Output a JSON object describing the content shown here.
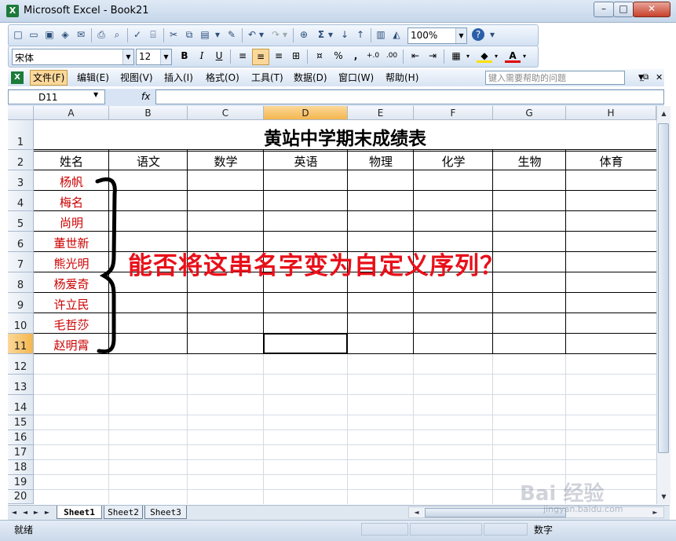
{
  "window": {
    "title": "Microsoft Excel - Book21",
    "app_icon": "excel-icon"
  },
  "toolbar": {
    "zoom": "100%",
    "font_name": "宋体",
    "font_size": "12",
    "bold_label": "B",
    "italic_label": "I",
    "underline_label": "U",
    "percent_label": "%",
    "comma_label": ",",
    "increase_decimal_label": "+.0",
    "decrease_decimal_label": ".00",
    "sum_label": "Σ",
    "font_color_label": "A",
    "help_icon": "?"
  },
  "menu": {
    "items": [
      "文件(F)",
      "编辑(E)",
      "视图(V)",
      "插入(I)",
      "格式(O)",
      "工具(T)",
      "数据(D)",
      "窗口(W)",
      "帮助(H)"
    ],
    "help_placeholder": "键入需要帮助的问题"
  },
  "formula_bar": {
    "name_box": "D11",
    "fx": "fx",
    "formula": ""
  },
  "columns": [
    "A",
    "B",
    "C",
    "D",
    "E",
    "F",
    "G",
    "H"
  ],
  "rows": [
    "1",
    "2",
    "3",
    "4",
    "5",
    "6",
    "7",
    "8",
    "9",
    "10",
    "11",
    "12",
    "13",
    "14",
    "15",
    "16",
    "17",
    "18",
    "19",
    "20"
  ],
  "sheet": {
    "title": "黄站中学期末成绩表",
    "headers": [
      "姓名",
      "语文",
      "数学",
      "英语",
      "物理",
      "化学",
      "生物",
      "体育"
    ],
    "names": [
      "杨帆",
      "梅名",
      "尚明",
      "董世新",
      "熊光明",
      "杨爱奇",
      "许立民",
      "毛哲莎",
      "赵明霄"
    ]
  },
  "annotation": {
    "text": "能否将这串名字变为自定义序列？",
    "brace": "{"
  },
  "tabs": [
    "Sheet1",
    "Sheet2",
    "Sheet3"
  ],
  "status": {
    "left": "就绪",
    "mode": "数字"
  },
  "watermark": {
    "text": "Bai 经验",
    "url": "jingyan.baidu.com"
  },
  "colors": {
    "name_color": "#cc0000",
    "annotation_color": "#e8101a",
    "selected_header": "#f4b64e"
  }
}
